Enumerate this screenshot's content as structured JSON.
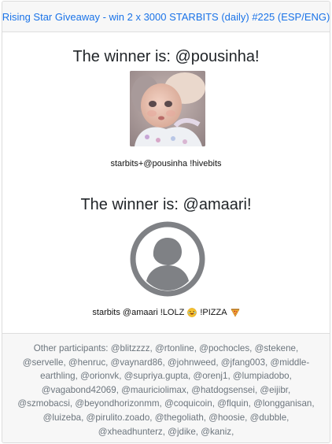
{
  "header": {
    "title": "Rising Star Giveaway - win 2 x 3000 STARBITS (daily) #225 (ESP/ENG)"
  },
  "winners": [
    {
      "title": "The winner is: @pousinha!",
      "avatar": "doll-photo",
      "line": "starbits+@pousinha !hivebits"
    },
    {
      "title": "The winner is: @amaari!",
      "avatar": "default-user-icon",
      "line_start": "starbits @amaari !LOLZ",
      "line_mid": "!PIZZA",
      "emoji_1": "rofl-emoji-icon",
      "emoji_2": "pizza-emoji-icon"
    }
  ],
  "footer": {
    "participants": "Other participants: @blitzzzz, @rtonline, @pochocles, @stekene, @servelle, @henruc, @vaynard86, @johnweed, @jfang003, @middle-earthling, @orionvk, @supriya.gupta, @orenj1, @lumpiadobo, @vagabond42069, @mauriciolimax, @hatdogsensei, @eijibr, @szmobacsi, @beyondhorizonmm, @coquicoin, @flquin, @longganisan, @luizeba, @pirulito.zoado, @thegoliath, @hoosie, @dubble, @xheadhunterz, @jdike, @kaniz,"
  },
  "colors": {
    "link": "#1a73e8",
    "muted": "#6c757d",
    "avatar_gray": "#7f8185"
  }
}
